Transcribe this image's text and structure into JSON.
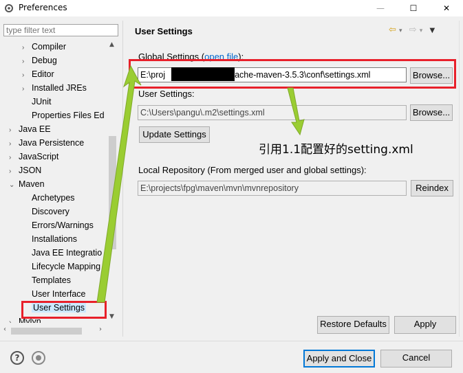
{
  "window": {
    "title": "Preferences",
    "minimize": "—",
    "maximize": "☐",
    "close": "✕"
  },
  "filter": {
    "placeholder": "type filter text"
  },
  "tree": [
    {
      "label": "Compiler",
      "indent": 1,
      "chev": "›"
    },
    {
      "label": "Debug",
      "indent": 1,
      "chev": "›"
    },
    {
      "label": "Editor",
      "indent": 1,
      "chev": "›"
    },
    {
      "label": "Installed JREs",
      "indent": 1,
      "chev": "›"
    },
    {
      "label": "JUnit",
      "indent": 1,
      "chev": ""
    },
    {
      "label": "Properties Files Ed",
      "indent": 1,
      "chev": ""
    },
    {
      "label": "Java EE",
      "indent": 0,
      "chev": "›"
    },
    {
      "label": "Java Persistence",
      "indent": 0,
      "chev": "›"
    },
    {
      "label": "JavaScript",
      "indent": 0,
      "chev": "›"
    },
    {
      "label": "JSON",
      "indent": 0,
      "chev": "›"
    },
    {
      "label": "Maven",
      "indent": 0,
      "chev": "⌄"
    },
    {
      "label": "Archetypes",
      "indent": 1,
      "chev": ""
    },
    {
      "label": "Discovery",
      "indent": 1,
      "chev": ""
    },
    {
      "label": "Errors/Warnings",
      "indent": 1,
      "chev": ""
    },
    {
      "label": "Installations",
      "indent": 1,
      "chev": ""
    },
    {
      "label": "Java EE Integratio",
      "indent": 1,
      "chev": ""
    },
    {
      "label": "Lifecycle Mapping",
      "indent": 1,
      "chev": ""
    },
    {
      "label": "Templates",
      "indent": 1,
      "chev": ""
    },
    {
      "label": "User Interface",
      "indent": 1,
      "chev": ""
    },
    {
      "label": "User Settings",
      "indent": 1,
      "chev": "",
      "selected": true
    },
    {
      "label": "Mylyn",
      "indent": 0,
      "chev": "›"
    }
  ],
  "page": {
    "title": "User Settings",
    "global_label": "Global Settings (",
    "global_link": "open file",
    "global_label_end": "):",
    "global_value_start": "E:\\proj",
    "global_value_end": "pache-maven-3.5.3\\conf\\settings.xml",
    "browse": "Browse...",
    "user_label": "User Settings:",
    "user_value": "C:\\Users\\pangu\\.m2\\settings.xml",
    "update": "Update Settings",
    "annotation": "引用1.1配置好的setting.xml",
    "repo_label": "Local Repository (From merged user and global settings):",
    "repo_value": "E:\\projects\\fpg\\maven\\mvn\\mvnrepository",
    "reindex": "Reindex",
    "restore": "Restore Defaults",
    "apply": "Apply"
  },
  "footer": {
    "help_icon": "?",
    "apply_close": "Apply and Close",
    "cancel": "Cancel"
  },
  "colors": {
    "highlight": "#e8202a",
    "arrow": "#9acd32",
    "link": "#0066cc"
  }
}
